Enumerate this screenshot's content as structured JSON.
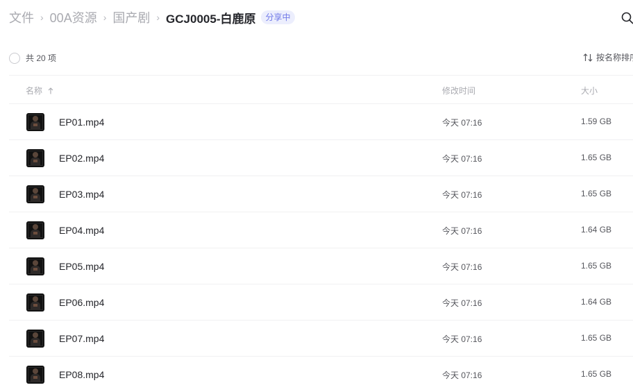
{
  "breadcrumb": {
    "items": [
      "文件",
      "00A资源",
      "国产剧"
    ],
    "separator": "›",
    "current": "GCJ0005-白鹿原",
    "badge": "分享中"
  },
  "toolbar": {
    "count": "共 20 项",
    "sort_label": "按名称排序"
  },
  "table": {
    "headers": {
      "name": "名称",
      "modified": "修改时间",
      "size": "大小"
    },
    "rows": [
      {
        "name": "EP01.mp4",
        "modified": "今天 07:16",
        "size": "1.59 GB"
      },
      {
        "name": "EP02.mp4",
        "modified": "今天 07:16",
        "size": "1.65 GB"
      },
      {
        "name": "EP03.mp4",
        "modified": "今天 07:16",
        "size": "1.65 GB"
      },
      {
        "name": "EP04.mp4",
        "modified": "今天 07:16",
        "size": "1.64 GB"
      },
      {
        "name": "EP05.mp4",
        "modified": "今天 07:16",
        "size": "1.65 GB"
      },
      {
        "name": "EP06.mp4",
        "modified": "今天 07:16",
        "size": "1.64 GB"
      },
      {
        "name": "EP07.mp4",
        "modified": "今天 07:16",
        "size": "1.65 GB"
      },
      {
        "name": "EP08.mp4",
        "modified": "今天 07:16",
        "size": "1.65 GB"
      }
    ]
  },
  "icons": {
    "search": "search-icon",
    "sort": "sort-arrows-icon",
    "sort_direction": "arrow-up-icon",
    "file_thumbnail": "video-thumbnail"
  },
  "colors": {
    "text_primary": "#25262b",
    "text_muted": "#a9aab0",
    "badge_text": "#6f78e8",
    "badge_bg": "#eceefd",
    "divider": "#f0f0f2"
  }
}
